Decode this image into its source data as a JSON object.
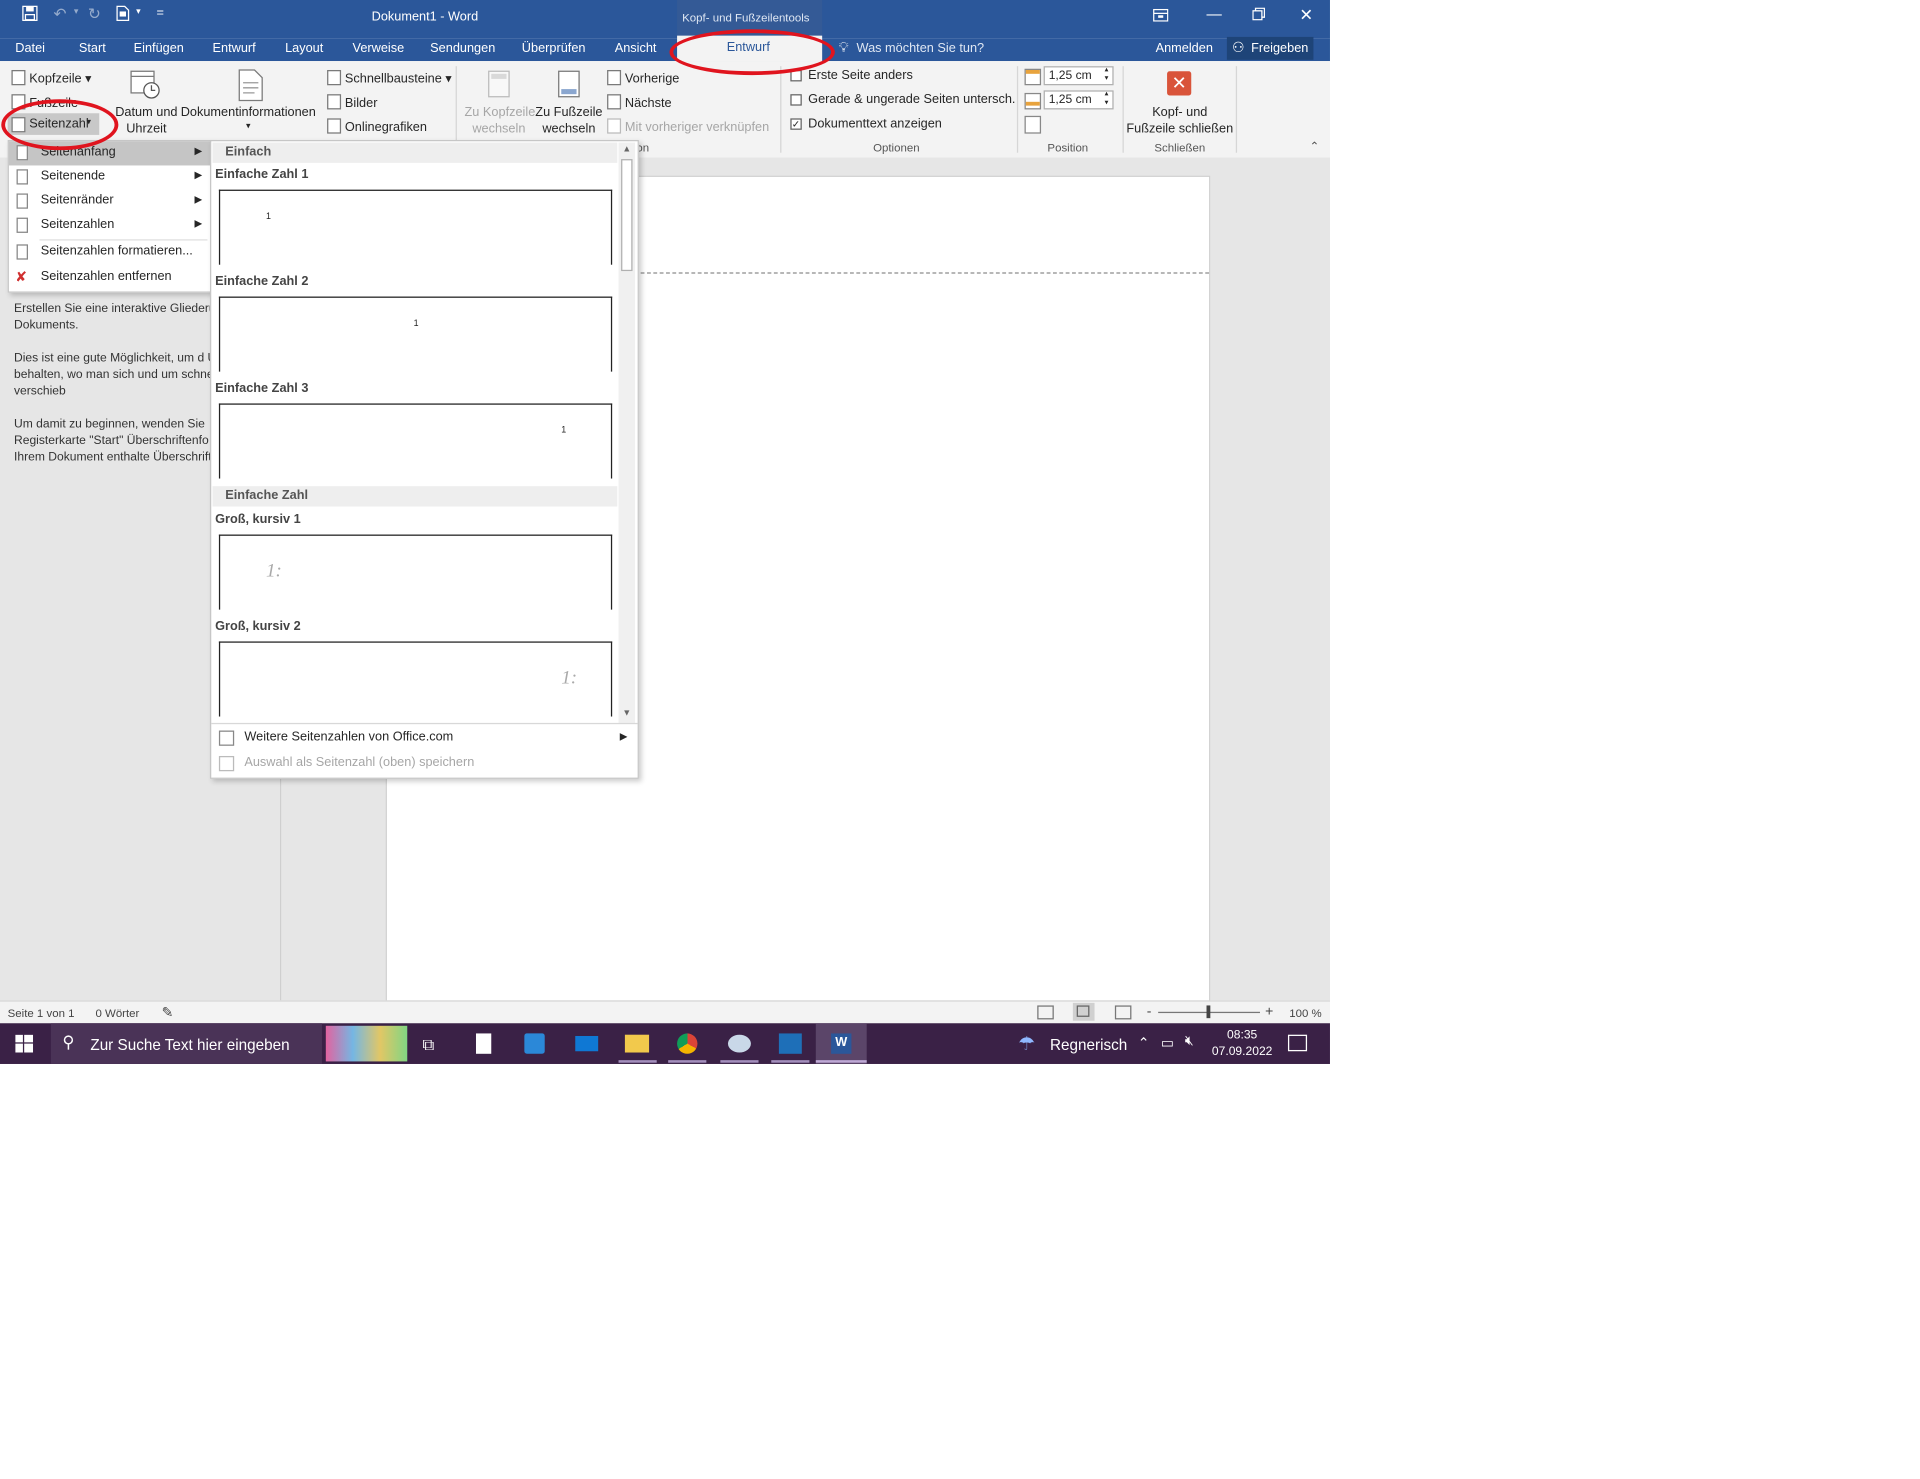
{
  "titlebar": {
    "title": "Dokument1 - Word",
    "context_label": "Kopf- und Fußzeilentools",
    "qat_customize": "="
  },
  "tabs": {
    "datei": "Datei",
    "start": "Start",
    "einfuegen": "Einfügen",
    "entwurf": "Entwurf",
    "layout": "Layout",
    "verweise": "Verweise",
    "sendungen": "Sendungen",
    "ueberpruefen": "Überprüfen",
    "ansicht": "Ansicht",
    "entwurf_context": "Entwurf",
    "tell_me": "Was möchten Sie tun?",
    "anmelden": "Anmelden",
    "freigeben": "Freigeben"
  },
  "ribbon": {
    "kopfzeile": "Kopfzeile",
    "fusszeile": "Fußzeile",
    "seitenzahl": "Seitenzahl",
    "datum_line1": "Datum und",
    "datum_line2": "Uhrzeit",
    "dokinfo": "Dokumentinformationen",
    "schnellbausteine": "Schnellbausteine",
    "bilder": "Bilder",
    "onlinegrafiken": "Onlinegrafiken",
    "zu_kopf_line1": "Zu Kopfzeile",
    "zu_kopf_line2": "wechseln",
    "zu_fuss_line1": "Zu Fußzeile",
    "zu_fuss_line2": "wechseln",
    "vorherige": "Vorherige",
    "naechste": "Nächste",
    "verknuepfen": "Mit vorheriger verknüpfen",
    "erste_seite": "Erste Seite anders",
    "gerade_ungerade": "Gerade & ungerade Seiten untersch.",
    "dokumenttext": "Dokumenttext anzeigen",
    "pos_top": "1,25 cm",
    "pos_bottom": "1,25 cm",
    "close_line1": "Kopf- und",
    "close_line2": "Fußzeile schließen",
    "group_navigation_tail": "on",
    "group_optionen": "Optionen",
    "group_position": "Position",
    "group_schliessen": "Schließen"
  },
  "menu": {
    "seitenanfang": "Seitenanfang",
    "seitenende": "Seitenende",
    "seitenraender": "Seitenränder",
    "seitenzahlen": "Seitenzahlen",
    "formatieren": "Seitenzahlen formatieren...",
    "entfernen": "Seitenzahlen entfernen"
  },
  "gallery": {
    "header1": "Einfach",
    "item1": "Einfache Zahl 1",
    "item2": "Einfache Zahl 2",
    "item3": "Einfache Zahl 3",
    "header2": "Einfache Zahl",
    "item4": "Groß, kursiv 1",
    "item5": "Groß, kursiv 2",
    "preview_small": "1",
    "preview_big": "1:",
    "more": "Weitere Seitenzahlen von Office.com",
    "save_selection": "Auswahl als Seitenzahl (oben) speichern"
  },
  "navpane": {
    "p1": "Erstellen Sie eine interaktive Gliederu Dokuments.",
    "p2": "Dies ist eine gute Möglichkeit, um d Überblick zu behalten, wo man sich und um schnell Inhalte zu verschieb",
    "p3": "Um damit zu beginnen, wenden Sie Registerkarte \"Start\" Überschriftenfo auf die in Ihrem Dokument enthalte Überschriften an."
  },
  "statusbar": {
    "page": "Seite 1 von 1",
    "words": "0 Wörter",
    "zoom": "100 %",
    "minus": "-",
    "plus": "+"
  },
  "taskbar": {
    "search_placeholder": "Zur Suche Text hier eingeben",
    "weather": "Regnerisch",
    "time": "08:35",
    "date": "07.09.2022"
  },
  "colors": {
    "accent": "#2b579a",
    "highlight_oval": "#e0141e",
    "taskbar": "#3a2146"
  }
}
